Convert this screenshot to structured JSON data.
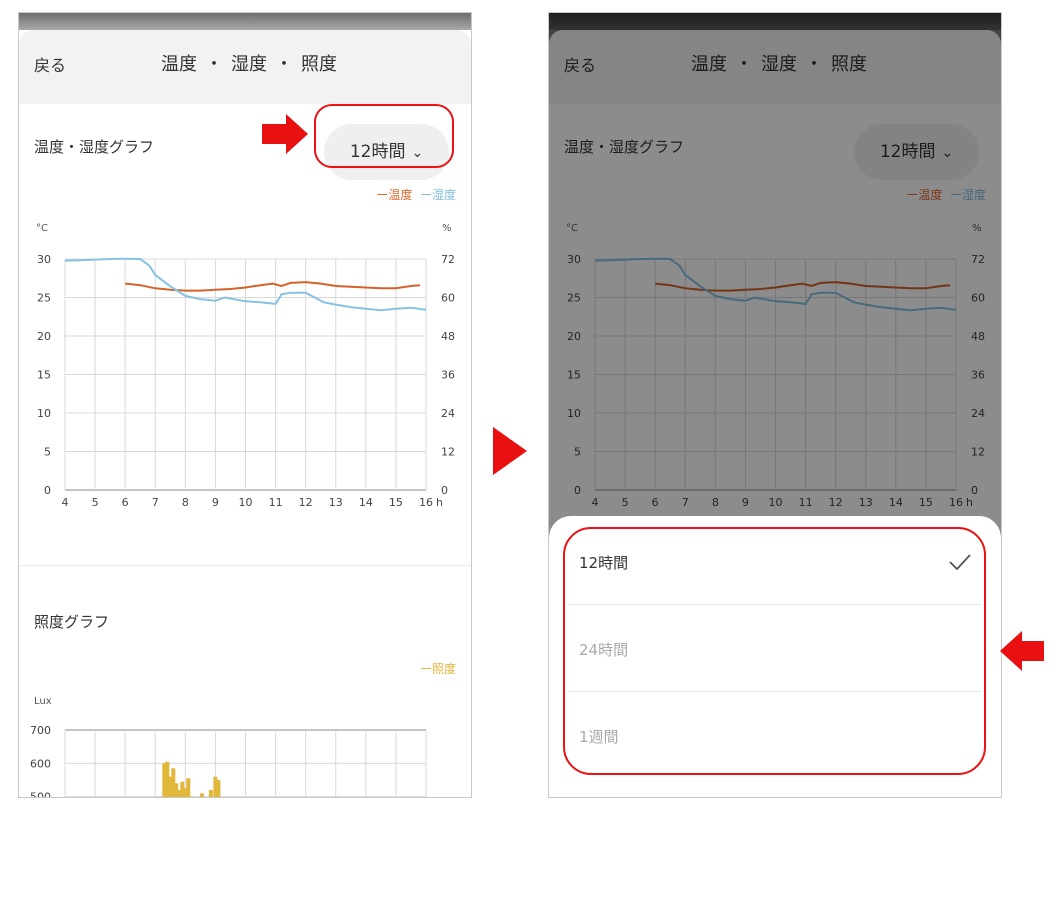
{
  "screen": {
    "back_label": "戻る",
    "title_parts": [
      "温度",
      "湿度",
      "照度"
    ],
    "title_sep": "・"
  },
  "temp_section": {
    "title": "温度・湿度グラフ",
    "range_label": "12時間",
    "legend": {
      "temp": "温度",
      "humidity": "湿度"
    },
    "legend_dash": "ー"
  },
  "lux_section": {
    "title": "照度グラフ",
    "legend": {
      "lux": "照度"
    },
    "legend_dash": "ー"
  },
  "chart_data": [
    {
      "type": "line",
      "title": "温度・湿度グラフ",
      "x_ticks": [
        "4",
        "5",
        "6",
        "7",
        "8",
        "9",
        "10",
        "11",
        "12",
        "13",
        "14",
        "15",
        "16"
      ],
      "x_unit": "h",
      "xlim": [
        4,
        16
      ],
      "y_left_label": "°C",
      "y_left_ticks": [
        0,
        5,
        10,
        15,
        20,
        25,
        30
      ],
      "y_left_lim": [
        0,
        30
      ],
      "y_right_label": "%",
      "y_right_ticks": [
        0,
        12,
        24,
        36,
        48,
        60,
        72
      ],
      "y_right_lim": [
        0,
        72
      ],
      "grid": true,
      "legend_position": "top-right",
      "series": [
        {
          "name": "温度",
          "color": "#d4622a",
          "axis": "left",
          "x": [
            6.0,
            6.5,
            7.0,
            7.5,
            8.0,
            8.5,
            9.0,
            9.5,
            10.0,
            10.5,
            10.9,
            11.2,
            11.5,
            12.0,
            12.5,
            13.0,
            13.5,
            14.0,
            14.5,
            15.0,
            15.5,
            15.8
          ],
          "y": [
            26.8,
            26.6,
            26.2,
            26.0,
            25.9,
            25.9,
            26.0,
            26.1,
            26.3,
            26.6,
            26.8,
            26.5,
            26.9,
            27.0,
            26.8,
            26.5,
            26.4,
            26.3,
            26.2,
            26.2,
            26.5,
            26.6
          ]
        },
        {
          "name": "湿度",
          "color": "#86c2e3",
          "axis": "right",
          "x": [
            4.0,
            4.5,
            5.0,
            5.5,
            6.0,
            6.5,
            6.8,
            7.0,
            7.5,
            8.0,
            8.5,
            9.0,
            9.3,
            9.6,
            10.0,
            10.5,
            11.0,
            11.2,
            11.5,
            12.0,
            12.3,
            12.6,
            13.0,
            13.5,
            14.0,
            14.5,
            15.0,
            15.5,
            16.0
          ],
          "y": [
            71.5,
            71.6,
            71.8,
            72.0,
            72.1,
            72.0,
            70.0,
            67.0,
            63.5,
            60.5,
            59.5,
            59.0,
            60.0,
            59.5,
            58.8,
            58.5,
            58.0,
            61.0,
            61.5,
            61.5,
            60.0,
            58.5,
            57.8,
            57.0,
            56.5,
            56.0,
            56.5,
            56.8,
            56.2
          ]
        }
      ]
    },
    {
      "type": "bar",
      "title": "照度グラフ",
      "y_label": "Lux",
      "y_ticks": [
        500,
        600,
        700
      ],
      "ylim": [
        400,
        700
      ],
      "legend_position": "top-right",
      "grid": true,
      "series": [
        {
          "name": "照度",
          "color": "#e1b73a",
          "x": [
            7.0,
            7.15,
            7.3,
            7.4,
            7.5,
            7.6,
            7.7,
            7.8,
            7.9,
            8.0,
            8.1,
            8.2,
            8.3,
            8.4,
            8.55,
            8.7,
            8.85,
            9.0,
            9.1
          ],
          "y": [
            470,
            500,
            600,
            605,
            560,
            585,
            540,
            520,
            545,
            525,
            555,
            500,
            470,
            480,
            510,
            460,
            520,
            560,
            550
          ]
        }
      ]
    }
  ],
  "picker": {
    "options": [
      {
        "label": "12時間",
        "selected": true
      },
      {
        "label": "24時間",
        "selected": false
      },
      {
        "label": "1週間",
        "selected": false
      }
    ],
    "check_icon": "checkmark-icon"
  },
  "colors": {
    "highlight": "#e01010",
    "temp": "#d4622a",
    "humidity": "#86c2e3",
    "lux": "#e1b73a"
  }
}
